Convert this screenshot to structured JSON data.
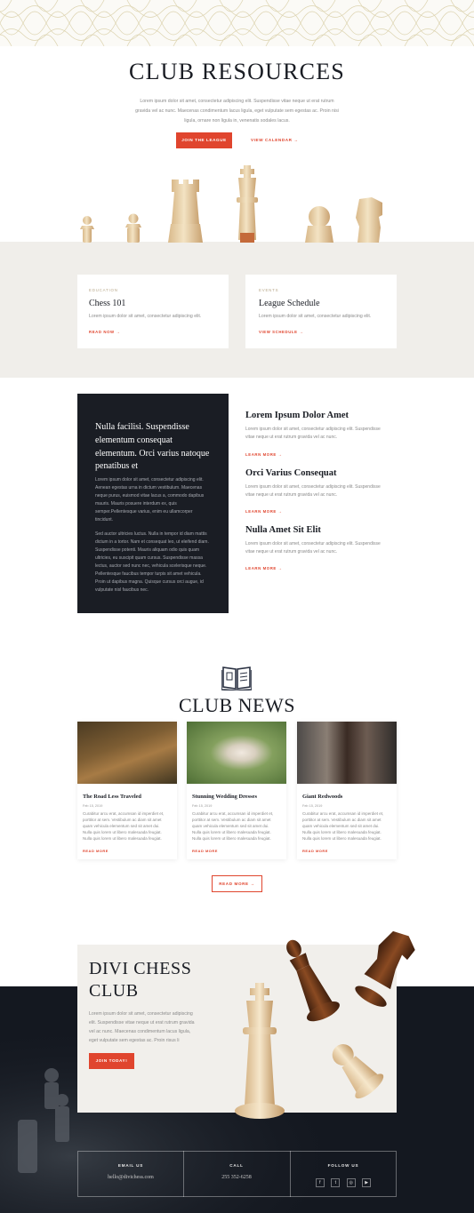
{
  "hero": {
    "title": "CLUB RESOURCES",
    "subtitle_line1": "Lorem ipsum dolor sit amet, consectetur adipiscing elit. Suspendisse vitae neque ut erat rutrum",
    "subtitle_line2": "gravida vel ac nunc. Maecenas condimentum lacus ligula, eget vulputate sem egestas ac. Proin nisi",
    "subtitle_line3": "ligula, ornare non ligula in, venenatis sodales lacus.",
    "primary_button": "JOIN THE LEAGUE",
    "secondary_link": "VIEW CALENDAR →"
  },
  "cards": [
    {
      "eyebrow": "EDUCATION",
      "title": "Chess 101",
      "text": "Lorem ipsum dolor sit amet, consectetur adipiscing elit.",
      "link": "READ NOW →"
    },
    {
      "eyebrow": "EVENTS",
      "title": "League Schedule",
      "text": "Lorem ipsum dolor sit amet, consectetur adipiscing elit.",
      "link": "VIEW SCHEDULE →"
    }
  ],
  "feature_block": {
    "title": "Nulla facilisi. Suspendisse elementum consequat elementum. Orci varius natoque penatibus et",
    "para1": "Lorem ipsum dolor sit amet, consectetur adipiscing elit. Aenean egestas urna in dictum vestibulum. Maecenas neque purus, euismod vitae lacus a, commodo dapibus mauris. Mauris posuere interdum ex, quis semper.Pellentesque varius, enim eu ullamcorper tincidunt.",
    "para2": "Sed auctor ultricies luctus. Nulla in tempor id diam mattis dictum in a tortor. Nam et consequat leo, ut eleifend diam. Suspendisse potenti. Mauris aliquam odio quis quam ultricies, eu suscipit quam cursus. Suspendisse massa lectus, auctor sed nunc nec, vehicula scelerisque neque. Pellentesque faucibus tempor turpis sit amet vehicula. Proin ut dapibus magna. Quisque cursus orci augue, id vulputate nisl faucibus nec."
  },
  "features": [
    {
      "title": "Lorem Ipsum Dolor Amet",
      "text_line1": "Lorem ipsum dolor sit amet, consectetur adipiscing elit. Suspendisse",
      "text_line2": "vitae neque ut erat rutrum gravida vel ac nunc.",
      "link": "LEARN MORE →"
    },
    {
      "title": "Orci Varius Consequat",
      "text_line1": "Lorem ipsum dolor sit amet, consectetur adipiscing elit. Suspendisse",
      "text_line2": "vitae neque ut erat rutrum gravida vel ac nunc.",
      "link": "LEARN MORE →"
    },
    {
      "title": "Nulla Amet Sit Elit",
      "text_line1": "Lorem ipsum dolor sit amet, consectetur adipiscing elit. Suspendisse",
      "text_line2": "vitae neque ut erat rutrum gravida vel ac nunc.",
      "link": "LEARN MORE →"
    }
  ],
  "news": {
    "title": "CLUB NEWS",
    "items": [
      {
        "title": "The Road Less Traveled",
        "date": "Feb 15, 2019",
        "text": "Curabitur arcu erat, accumsan id imperdiet et, porttitor at sem. Vestibulum ac diam sit amet quam vehicula elementum sed sit amet dui. Nulla quis lorem ut libero malesuada feugiat. Nulla quis lorem ut libero malesuada feugiat.",
        "link": "READ MORE"
      },
      {
        "title": "Stunning Wedding Dresses",
        "date": "Feb 15, 2019",
        "text": "Curabitur arcu erat, accumsan id imperdiet et, porttitor at sem. Vestibulum ac diam sit amet quam vehicula elementum sed sit amet dui. Nulla quis lorem ut libero malesuada feugiat. Nulla quis lorem ut libero malesuada feugiat.",
        "link": "READ MORE"
      },
      {
        "title": "Giant Redwoods",
        "date": "Feb 15, 2019",
        "text": "Curabitur arcu erat, accumsan id imperdiet et, porttitor at sem. Vestibulum ac diam sit amet quam vehicula elementum sed sit amet dui. Nulla quis lorem ut libero malesuada feugiat. Nulla quis lorem ut libero malesuada feugiat.",
        "link": "READ MORE"
      }
    ],
    "more_button": "READ MORE →"
  },
  "cta": {
    "title_line1": "DIVI CHESS",
    "title_line2": "CLUB",
    "text": "Lorem ipsum dolor sit amet, consectetur adipiscing elit. Suspendisse vitae neque ut erat rutrum gravida vel ac nunc. Maecenas condimentum lacus ligula, eget vulputate sem egestas ac. Proin risus li",
    "button": "JOIN TODAY!"
  },
  "footer": {
    "email_label": "EMAIL US",
    "email_value": "hello@divichess.com",
    "call_label": "CALL",
    "call_value": "255 352-6258",
    "follow_label": "FOLLOW US",
    "social": [
      "f",
      "t",
      "◎",
      "▶"
    ]
  },
  "colors": {
    "accent": "#e0452e",
    "dark": "#1a1d24",
    "band": "#f0eeea",
    "gold": "#b8a88a"
  }
}
